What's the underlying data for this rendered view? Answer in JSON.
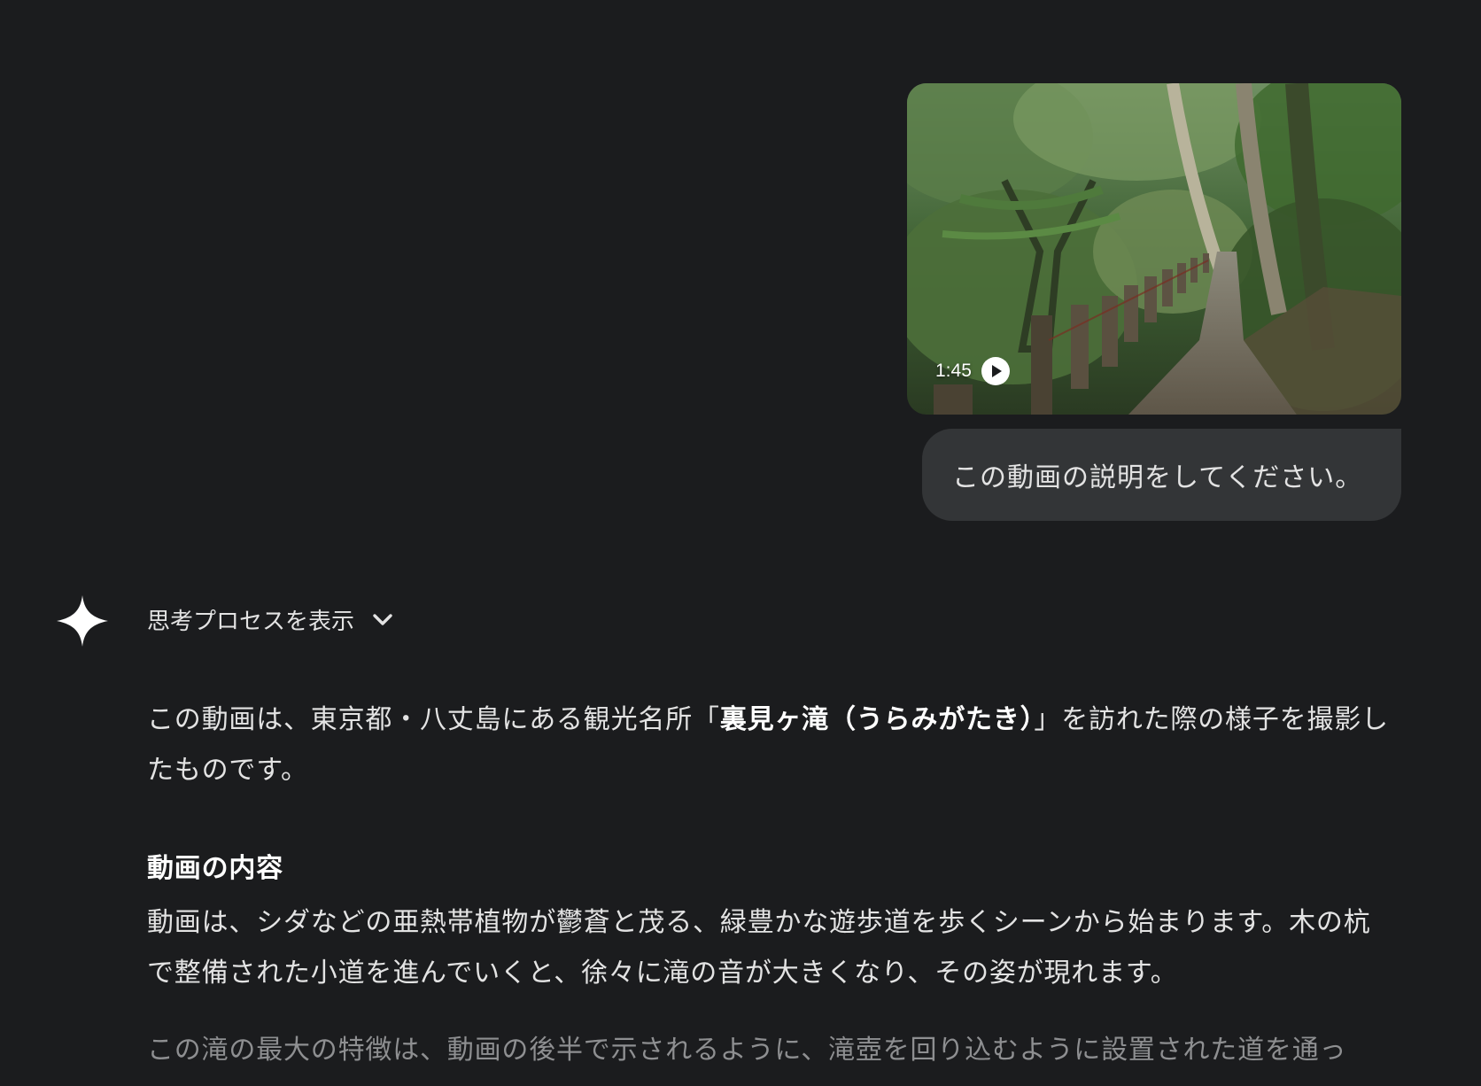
{
  "user_message": {
    "video": {
      "duration": "1:45",
      "play_icon": "play-circle-icon"
    },
    "text": "この動画の説明をしてください。"
  },
  "assistant": {
    "icon": "sparkle-icon",
    "thinking_toggle": {
      "label": "思考プロセスを表示",
      "icon": "chevron-down-icon"
    },
    "intro": {
      "part1": "この動画は、東京都・八丈島にある観光名所「",
      "bold": "裏見ヶ滝（うらみがたき）",
      "part2": "」を訪れた際の様子を撮影したものです。"
    },
    "section_heading": "動画の内容",
    "paragraph1": "動画は、シダなどの亜熱帯植物が鬱蒼と茂る、緑豊かな遊歩道を歩くシーンから始まります。木の杭で整備された小道を進んでいくと、徐々に滝の音が大きくなり、その姿が現れます。",
    "paragraph2_partial": "この滝の最大の特徴は、動画の後半で示されるように、滝壺を回り込むように設置された道を通っ"
  }
}
